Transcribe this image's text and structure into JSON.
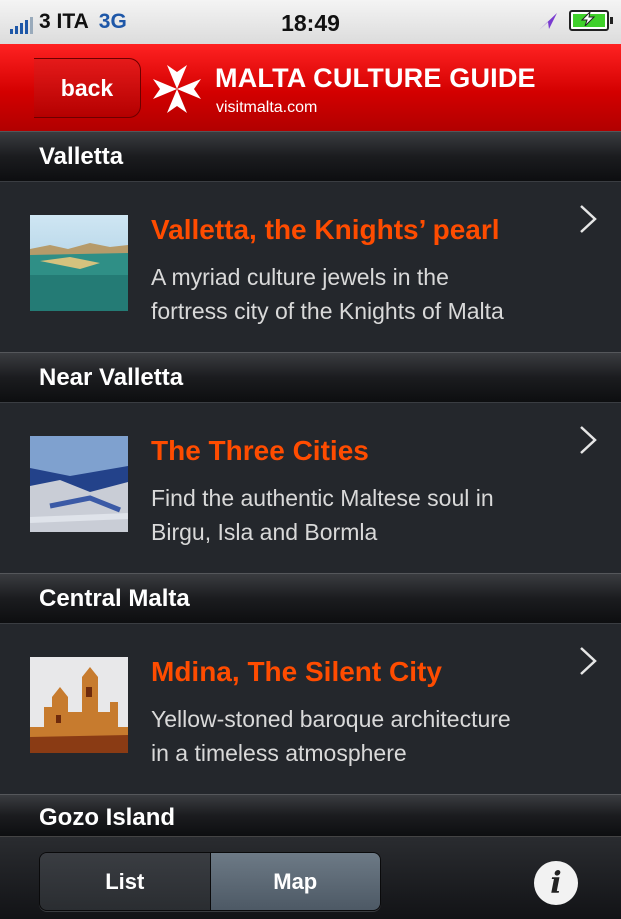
{
  "status_bar": {
    "carrier": "3 ITA",
    "network": "3G",
    "time": "18:49"
  },
  "header": {
    "back_label": "back",
    "title": "MALTA CULTURE GUIDE",
    "subtitle": "visitmalta.com"
  },
  "sections": [
    {
      "label": "Valletta",
      "item": {
        "title": "Valletta, the Knights’ pearl",
        "line1": "A myriad culture jewels in the",
        "line2": "fortress city of the Knights of Malta"
      }
    },
    {
      "label": "Near Valletta",
      "item": {
        "title": "The Three Cities",
        "line1": "Find the authentic Maltese soul in",
        "line2": "Birgu, Isla and Bormla"
      }
    },
    {
      "label": "Central Malta",
      "item": {
        "title": "Mdina, The Silent City",
        "line1": "Yellow-stoned baroque architecture",
        "line2": "in a timeless atmosphere"
      }
    },
    {
      "label": "Gozo Island"
    }
  ],
  "tabbar": {
    "list_label": "List",
    "map_label": "Map",
    "info_glyph": "i"
  },
  "colors": {
    "header_red": "#d30000",
    "title_orange": "#ff4c00",
    "background": "#24272c"
  }
}
